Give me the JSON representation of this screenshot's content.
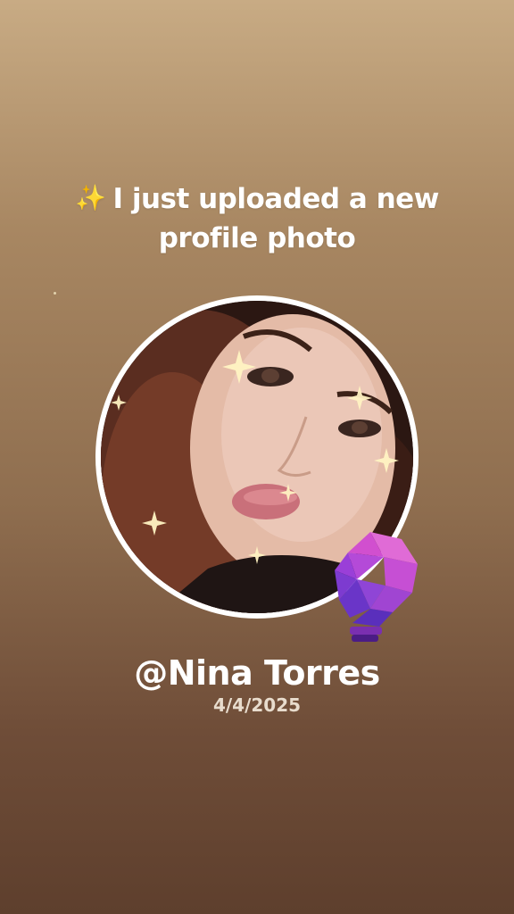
{
  "headline": {
    "emoji": "✨",
    "line1": "I just uploaded a new",
    "line2": "profile photo"
  },
  "profile": {
    "username": "@Nina Torres",
    "date": "4/4/2025",
    "avatar_icon": "profile-photo",
    "badge_icon": "lightbulb-icon"
  },
  "colors": {
    "background_top": "#c8ab84",
    "background_bottom": "#5e3f2d",
    "ring": "#ffffff",
    "badge_purple": "#8a3fd1",
    "badge_pink": "#d04fd0"
  }
}
